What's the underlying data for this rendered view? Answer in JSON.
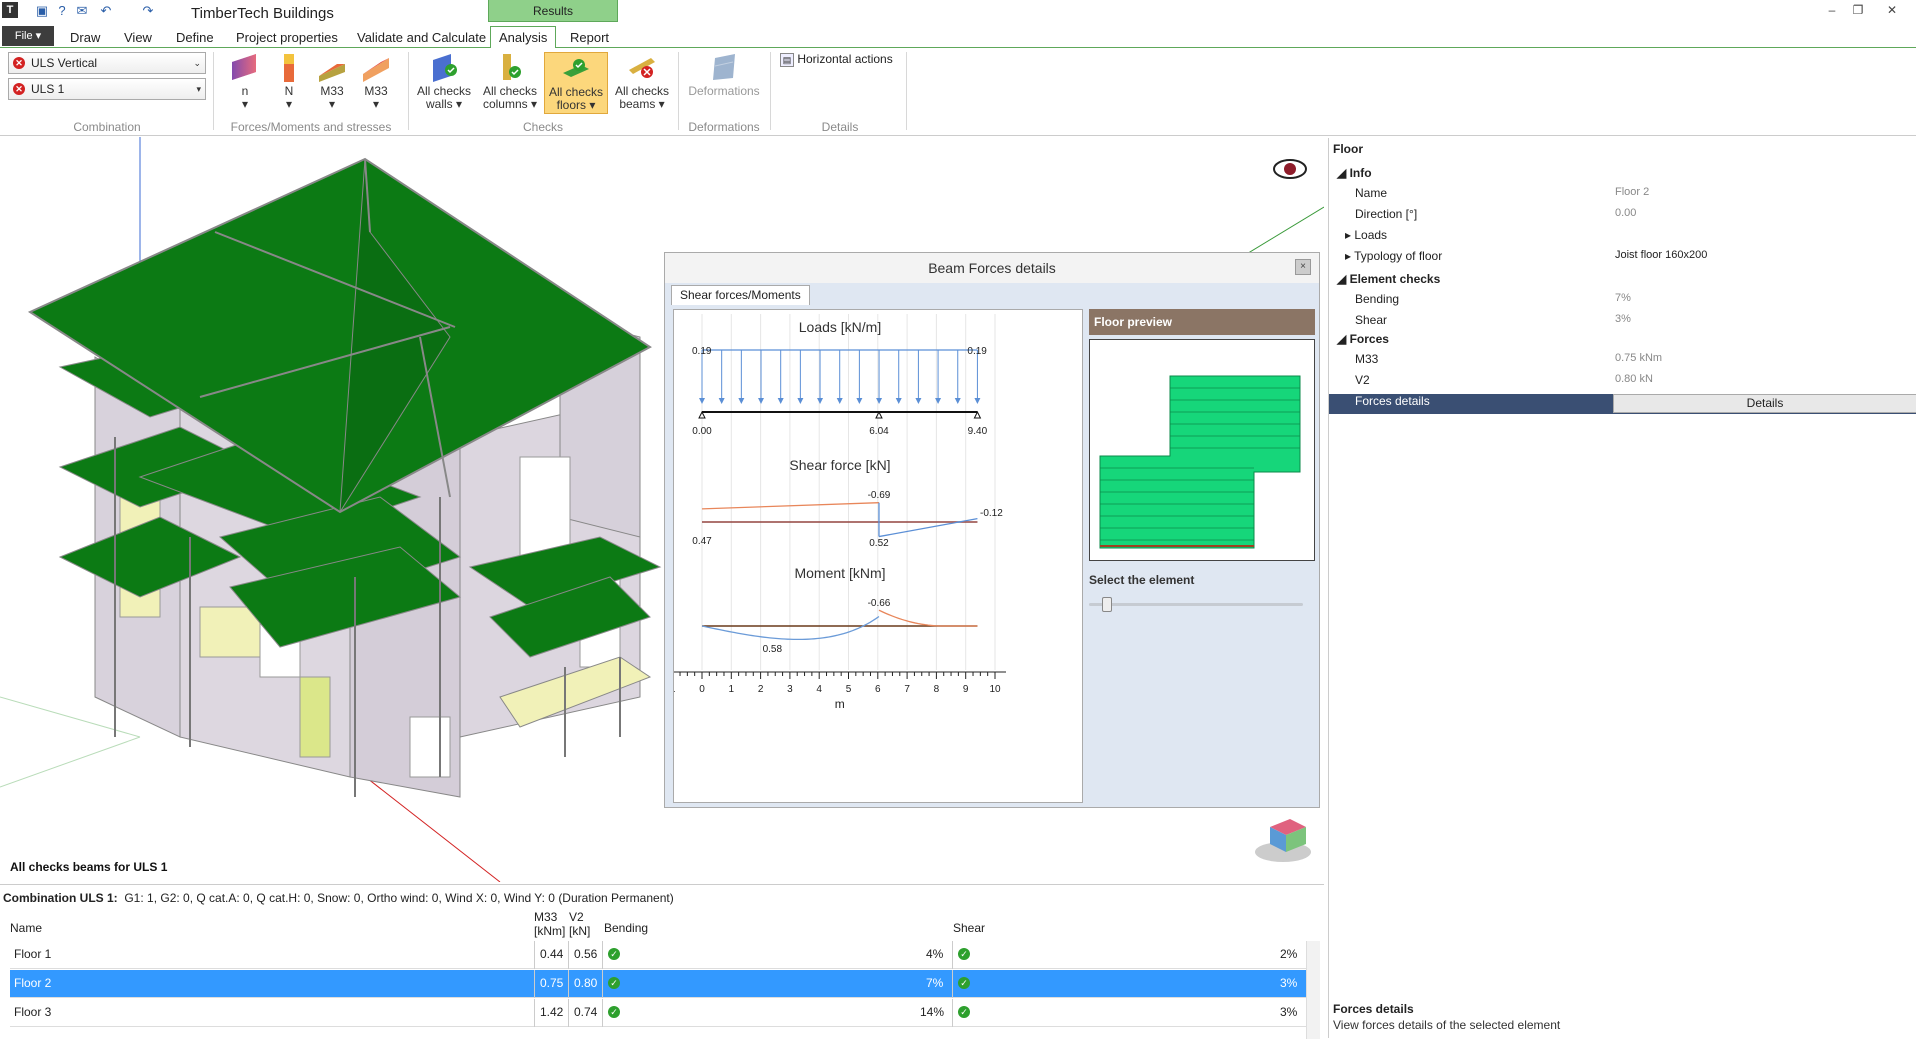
{
  "app": {
    "title": "TimberTech Buildings",
    "results_tab": "Results"
  },
  "menu": {
    "file": "File",
    "tabs": [
      "Draw",
      "View",
      "Define",
      "Project properties",
      "Validate and Calculate",
      "Analysis",
      "Report"
    ],
    "active": "Analysis"
  },
  "ribbon": {
    "combination": {
      "combo1": "ULS Vertical",
      "combo2": "ULS 1",
      "label": "Combination"
    },
    "forces_group": {
      "buttons": [
        "n",
        "N",
        "M33",
        "M33"
      ],
      "label": "Forces/Moments and stresses"
    },
    "checks_group": {
      "buttons": [
        "All checks walls",
        "All checks columns",
        "All checks floors",
        "All checks beams"
      ],
      "label": "Checks"
    },
    "deformations_group": {
      "button": "Deformations",
      "label": "Deformations"
    },
    "details_group": {
      "button": "Horizontal actions",
      "label": "Details"
    }
  },
  "viewport": {
    "caption": "All checks beams for ULS 1"
  },
  "dialog": {
    "title": "Beam Forces details",
    "close": "×",
    "tab": "Shear forces/Moments",
    "preview_header": "Floor preview",
    "select_label": "Select the element",
    "slider_value": 0
  },
  "chart_data": [
    {
      "type": "line",
      "title": "Loads [kN/m]",
      "x": [
        0.0,
        9.4
      ],
      "values": [
        0.19,
        0.19
      ],
      "annotations": [
        "0.19",
        "0.19",
        "0.00",
        "6.04",
        "9.40"
      ],
      "supports": [
        0.0,
        6.04,
        9.4
      ]
    },
    {
      "type": "line",
      "title": "Shear force [kN]",
      "series": [
        {
          "values": [
            [
              0.0,
              -0.47
            ],
            [
              6.04,
              -0.69
            ]
          ],
          "color": "#e8865a"
        },
        {
          "values": [
            [
              6.04,
              0.52
            ],
            [
              9.4,
              -0.12
            ]
          ],
          "color": "#5b8fd6"
        }
      ],
      "annotations": [
        "-0.69",
        "-0.12",
        "0.47",
        "0.52"
      ]
    },
    {
      "type": "line",
      "title": "Moment [kNm]",
      "series": [
        {
          "values": [
            [
              0.0,
              0.0
            ],
            [
              2.2,
              0.58
            ],
            [
              6.04,
              -0.66
            ],
            [
              8.2,
              0.0
            ],
            [
              9.4,
              0.0
            ]
          ]
        }
      ],
      "annotations": [
        "-0.66",
        "0.58"
      ],
      "xlabel": "m",
      "xticks": [
        "1",
        "0",
        "1",
        "2",
        "3",
        "4",
        "5",
        "6",
        "7",
        "8",
        "9",
        "10"
      ]
    }
  ],
  "props": {
    "title": "Floor",
    "rows": [
      {
        "cat": "Info"
      },
      {
        "k": "Name",
        "v": "Floor 2"
      },
      {
        "k": "Direction [°]",
        "v": "0.00"
      },
      {
        "k": "Loads",
        "v": ""
      },
      {
        "k": "Typology of floor",
        "v": "Joist floor 160x200"
      },
      {
        "cat": "Element checks"
      },
      {
        "k": "Bending",
        "v": "7%"
      },
      {
        "k": "Shear",
        "v": "3%"
      },
      {
        "cat": "Forces"
      },
      {
        "k": "M33",
        "v": "0.75 kNm"
      },
      {
        "k": "V2",
        "v": "0.80 kN"
      },
      {
        "k": "Forces details",
        "v": "Details"
      }
    ],
    "help_title": "Forces details",
    "help_desc": "View forces details of the selected element"
  },
  "table": {
    "combination_caption": "Combination ULS 1:",
    "combination_text": "G1: 1, G2: 0, Q cat.A: 0, Q cat.H: 0, Snow: 0, Ortho wind: 0, Wind X: 0, Wind Y: 0 (Duration Permanent)",
    "headers": [
      "Name",
      "M33 [kNm]",
      "V2 [kN]",
      "Bending",
      "Shear"
    ],
    "rows": [
      {
        "name": "Floor 1",
        "m33": "0.44",
        "v2": "0.56",
        "bending": "4%",
        "shear": "2%"
      },
      {
        "name": "Floor 2",
        "m33": "0.75",
        "v2": "0.80",
        "bending": "7%",
        "shear": "3%"
      },
      {
        "name": "Floor 3",
        "m33": "1.42",
        "v2": "0.74",
        "bending": "14%",
        "shear": "3%"
      }
    ],
    "selected_row": 1
  },
  "colors": {
    "accent_green": "#5ea85a",
    "floor_green": "#0c7a14",
    "selection_blue": "#3399ff"
  }
}
